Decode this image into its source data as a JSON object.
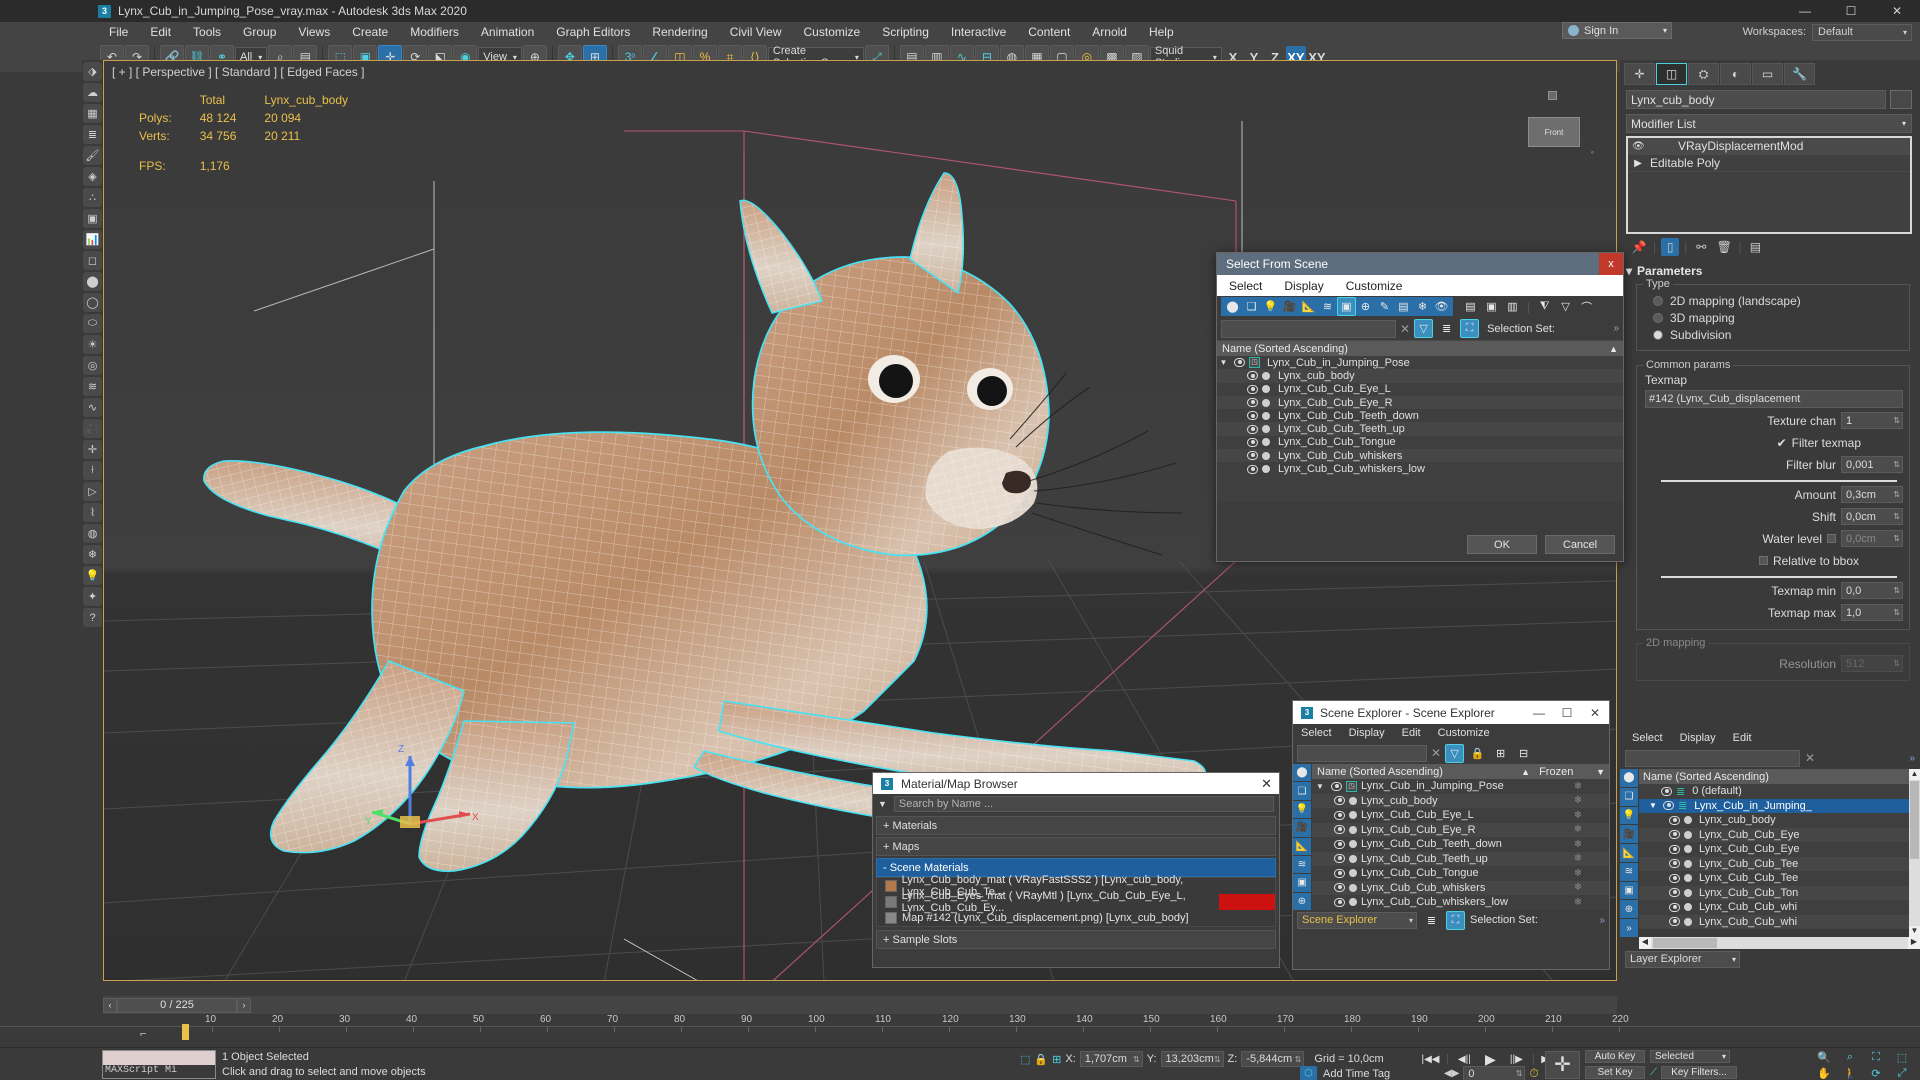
{
  "window": {
    "title": "Lynx_Cub_in_Jumping_Pose_vray.max - Autodesk 3ds Max 2020",
    "logo": "3",
    "minimize": "—",
    "maximize": "☐",
    "close": "✕"
  },
  "menubar": {
    "items": [
      "File",
      "Edit",
      "Tools",
      "Group",
      "Views",
      "Create",
      "Modifiers",
      "Animation",
      "Graph Editors",
      "Rendering",
      "Civil View",
      "Customize",
      "Scripting",
      "Interactive",
      "Content",
      "Arnold",
      "Help"
    ]
  },
  "signin": {
    "label": "Sign In",
    "caret": "▾"
  },
  "workspace": {
    "label": "Workspaces:",
    "value": "Default",
    "caret": "▾"
  },
  "toolbar": {
    "selection_filter": "All",
    "view_ref": "View",
    "selection_set": "Create Selection Se",
    "render_preset": "Squid Studio",
    "axis_x": "X",
    "axis_y": "Y",
    "axis_z": "Z",
    "axis_xy": "XY",
    "axis_xy2": "XY"
  },
  "viewport": {
    "label": "[ + ] [ Perspective ] [ Standard ] [ Edged Faces ]",
    "stats": {
      "col_total": "Total",
      "col_object": "Lynx_cub_body",
      "rows": [
        {
          "label": "Polys:",
          "total": "48 124",
          "object": "20 094"
        },
        {
          "label": "Verts:",
          "total": "34 756",
          "object": "20 211"
        }
      ],
      "fps_label": "FPS:",
      "fps_value": "1,176"
    },
    "axis_x": "X",
    "axis_y": "Y",
    "axis_z": "Z",
    "viewcube": "Front"
  },
  "command_panel": {
    "tabs": [
      "create",
      "modify",
      "hierarchy",
      "motion",
      "display",
      "utilities"
    ],
    "object_name": "Lynx_cub_body",
    "modifier_list_label": "Modifier List",
    "modifier_stack": [
      {
        "name": "VRayDisplacementMod",
        "visible": true
      },
      {
        "name": "Editable Poly",
        "visible": false
      }
    ],
    "rollout_title": "Parameters",
    "type_group": "Type",
    "type_options": [
      {
        "label": "2D mapping (landscape)",
        "selected": false
      },
      {
        "label": "3D mapping",
        "selected": false
      },
      {
        "label": "Subdivision",
        "selected": true
      }
    ],
    "common_group": "Common params",
    "texmap_label": "Texmap",
    "texmap_value": "#142 (Lynx_Cub_displacement",
    "fields": [
      {
        "label": "Texture chan",
        "value": "1"
      },
      {
        "label": "Filter blur",
        "value": "0,001"
      },
      {
        "label": "Amount",
        "value": "0,3cm"
      },
      {
        "label": "Shift",
        "value": "0,0cm"
      },
      {
        "label": "Water level",
        "value": "0,0cm"
      },
      {
        "label": "Texmap min",
        "value": "0,0"
      },
      {
        "label": "Texmap max",
        "value": "1,0"
      }
    ],
    "filter_texmap": "Filter texmap",
    "relative_bbox": "Relative to bbox",
    "mapping2d_group": "2D mapping",
    "resolution_label": "Resolution",
    "resolution_value": "512"
  },
  "select_from_scene": {
    "title": "Select From Scene",
    "close": "x",
    "menu": [
      "Select",
      "Display",
      "Customize"
    ],
    "search_placeholder": "",
    "search_value": "",
    "selection_set_label": "Selection Set:",
    "column_header": "Name (Sorted Ascending)",
    "sort_arrow": "▲",
    "root": "Lynx_Cub_in_Jumping_Pose",
    "children": [
      "Lynx_cub_body",
      "Lynx_Cub_Cub_Eye_L",
      "Lynx_Cub_Cub_Eye_R",
      "Lynx_Cub_Cub_Teeth_down",
      "Lynx_Cub_Cub_Teeth_up",
      "Lynx_Cub_Cub_Tongue",
      "Lynx_Cub_Cub_whiskers",
      "Lynx_Cub_Cub_whiskers_low"
    ],
    "ok": "OK",
    "cancel": "Cancel"
  },
  "material_browser": {
    "logo": "3",
    "title": "Material/Map Browser",
    "close": "✕",
    "search_placeholder": "Search by Name ...",
    "sections": [
      {
        "label": "+ Materials",
        "selected": false
      },
      {
        "label": "+ Maps",
        "selected": false
      },
      {
        "label": "- Scene Materials",
        "selected": true
      }
    ],
    "items": [
      {
        "name": "Lynx_Cub_body_mat  ( VRayFastSSS2 )  [Lynx_cub_body, Lynx_Cub_Cub_Te...",
        "swatch": "#b5784a",
        "highlight": false
      },
      {
        "name": "Lynx_Cub_Eyes_mat  ( VRayMtl )  [Lynx_Cub_Cub_Eye_L, Lynx_Cub_Cub_Ey...",
        "swatch": "#7a7a7a",
        "highlight": true
      },
      {
        "name": "Map #142 (Lynx_Cub_displacement.png)  [Lynx_cub_body]",
        "swatch": "#888888",
        "highlight": false
      }
    ],
    "footer": "+ Sample Slots"
  },
  "scene_explorer": {
    "logo": "3",
    "title": "Scene Explorer - Scene Explorer",
    "minimize": "—",
    "maximize": "☐",
    "close": "✕",
    "menu": [
      "Select",
      "Display",
      "Edit",
      "Customize"
    ],
    "search_value": "",
    "column_name": "Name (Sorted Ascending)",
    "column_frozen": "Frozen",
    "sort_arrow": "▲",
    "frozen_arrow": "▼",
    "root": "Lynx_Cub_in_Jumping_Pose",
    "children": [
      "Lynx_cub_body",
      "Lynx_Cub_Cub_Eye_L",
      "Lynx_Cub_Cub_Eye_R",
      "Lynx_Cub_Cub_Teeth_down",
      "Lynx_Cub_Cub_Teeth_up",
      "Lynx_Cub_Cub_Tongue",
      "Lynx_Cub_Cub_whiskers",
      "Lynx_Cub_Cub_whiskers_low"
    ],
    "footer_combo": "Scene Explorer",
    "selection_set_label": "Selection Set:"
  },
  "layer_explorer": {
    "menu": [
      "Select",
      "Display",
      "Edit"
    ],
    "search_value": "",
    "column_name": "Name (Sorted Ascending)",
    "rows": [
      {
        "label": "0 (default)",
        "selected": false,
        "layer": true
      },
      {
        "label": "Lynx_Cub_in_Jumping_",
        "selected": true,
        "layer": true
      },
      {
        "label": "Lynx_cub_body",
        "selected": false,
        "layer": false
      },
      {
        "label": "Lynx_Cub_Cub_Eye",
        "selected": false,
        "layer": false
      },
      {
        "label": "Lynx_Cub_Cub_Eye",
        "selected": false,
        "layer": false
      },
      {
        "label": "Lynx_Cub_Cub_Tee",
        "selected": false,
        "layer": false
      },
      {
        "label": "Lynx_Cub_Cub_Tee",
        "selected": false,
        "layer": false
      },
      {
        "label": "Lynx_Cub_Cub_Ton",
        "selected": false,
        "layer": false
      },
      {
        "label": "Lynx_Cub_Cub_whi",
        "selected": false,
        "layer": false
      },
      {
        "label": "Lynx_Cub_Cub_whi",
        "selected": false,
        "layer": false
      }
    ],
    "footer_combo": "Layer Explorer"
  },
  "trackbar": {
    "prev": "‹",
    "next": "›",
    "frame": "0 / 225"
  },
  "ruler": {
    "ticks": [
      "10",
      "20",
      "30",
      "40",
      "50",
      "60",
      "70",
      "80",
      "90",
      "100",
      "110",
      "120",
      "130",
      "140",
      "150",
      "160",
      "170",
      "180",
      "190",
      "200",
      "210",
      "220"
    ]
  },
  "status": {
    "mxs_label": "MAXScript Mi",
    "line1": "1 Object Selected",
    "line2": "Click and drag to select and move objects",
    "x_label": "X:",
    "x_value": "1,707cm",
    "y_label": "Y:",
    "y_value": "13,203cm",
    "z_label": "Z:",
    "z_value": "-5,844cm",
    "grid": "Grid = 10,0cm",
    "add_time_tag": "Add Time Tag",
    "key_frame": "0",
    "auto_key": "Auto Key",
    "set_key": "Set Key",
    "key_filters": "Key Filters...",
    "key_mode": "Selected"
  },
  "colors": {
    "accent_blue": "#2a6fa8",
    "selection_cyan": "#4dd0e1",
    "viewport_border": "#c8a24a",
    "stats_yellow": "#e8c04a"
  }
}
